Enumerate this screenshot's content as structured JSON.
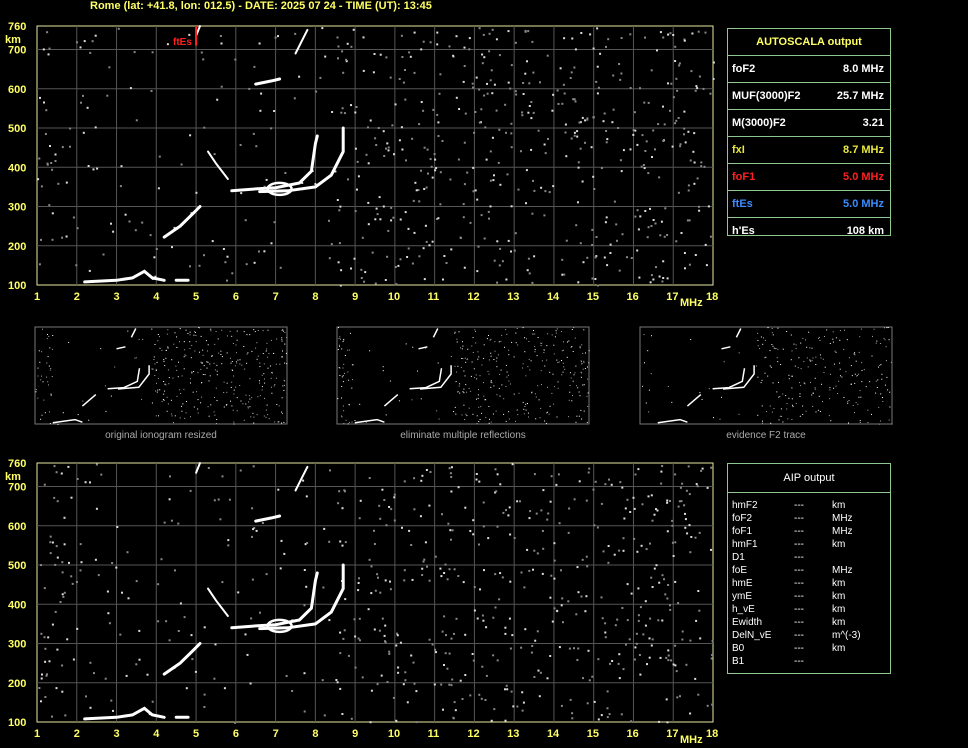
{
  "header": "Rome  (lat:  +41.8,  lon:  012.5)  -  DATE:  2025 07 24  -  TIME (UT):  13:45",
  "axes": {
    "y_unit": "km",
    "x_unit": "MHz",
    "y_ticks": [
      "760",
      "700",
      "600",
      "500",
      "400",
      "300",
      "200",
      "100"
    ],
    "x_ticks": [
      "1",
      "2",
      "3",
      "4",
      "5",
      "6",
      "7",
      "8",
      "9",
      "10",
      "11",
      "12",
      "13",
      "14",
      "15",
      "16",
      "17",
      "18"
    ],
    "marker_label": "ftEs"
  },
  "autoscala": {
    "title": "AUTOSCALA output",
    "rows": [
      {
        "label": "foF2",
        "value": "8.0 MHz",
        "color": "#ffffff"
      },
      {
        "label": "MUF(3000)F2",
        "value": "25.7 MHz",
        "color": "#ffffff"
      },
      {
        "label": "M(3000)F2",
        "value": "3.21",
        "color": "#ffffff"
      },
      {
        "label": "fxI",
        "value": "8.7 MHz",
        "color": "#e8e840"
      },
      {
        "label": "foF1",
        "value": "5.0 MHz",
        "color": "#ff2020"
      },
      {
        "label": "ftEs",
        "value": "5.0 MHz",
        "color": "#3a8cff"
      },
      {
        "label": "h'Es",
        "value": "108    km",
        "color": "#ffffff"
      }
    ]
  },
  "captions": [
    "original ionogram resized",
    "eliminate multiple reflections",
    "evidence F2 trace"
  ],
  "aip": {
    "title": "AIP output",
    "rows": [
      {
        "a": "hmF2",
        "b": "---",
        "c": "km"
      },
      {
        "a": "foF2",
        "b": "---",
        "c": "MHz"
      },
      {
        "a": "foF1",
        "b": "---",
        "c": "MHz"
      },
      {
        "a": "hmF1",
        "b": "---",
        "c": "km"
      },
      {
        "a": "D1",
        "b": "---",
        "c": ""
      },
      {
        "a": "foE",
        "b": "---",
        "c": "MHz"
      },
      {
        "a": "hmE",
        "b": "---",
        "c": "km"
      },
      {
        "a": "ymE",
        "b": "---",
        "c": "km"
      },
      {
        "a": "h_vE",
        "b": "---",
        "c": "km"
      },
      {
        "a": "Ewidth",
        "b": "---",
        "c": "km"
      },
      {
        "a": "DelN_vE",
        "b": "---",
        "c": "m^(-3)"
      },
      {
        "a": "B0",
        "b": "---",
        "c": "km"
      },
      {
        "a": "B1",
        "b": "---",
        "c": ""
      }
    ]
  }
}
